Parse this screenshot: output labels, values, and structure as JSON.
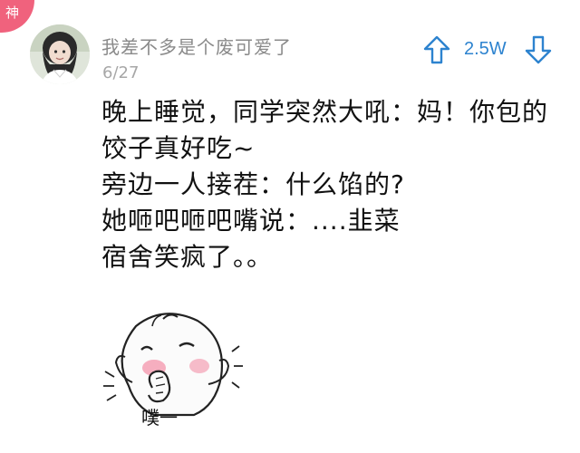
{
  "badge": {
    "label": "神"
  },
  "comment": {
    "username": "我差不多是个废可爱了",
    "date": "6/27",
    "vote_count": "2.5W",
    "body_lines": [
      "晚上睡觉，同学突然大吼：妈！你包的",
      "饺子真好吃~",
      "旁边一人接茬：什么馅的?",
      "她咂吧咂吧嘴说：....韭菜",
      "宿舍笑疯了。。"
    ],
    "sticker_caption": "噗一"
  },
  "icons": {
    "upvote": "arrow-up-icon",
    "downvote": "arrow-down-icon"
  },
  "colors": {
    "badge": "#f0627d",
    "vote": "#2d83cf",
    "username": "#8a8a8a",
    "date": "#a7a7a7",
    "text": "#111111"
  }
}
